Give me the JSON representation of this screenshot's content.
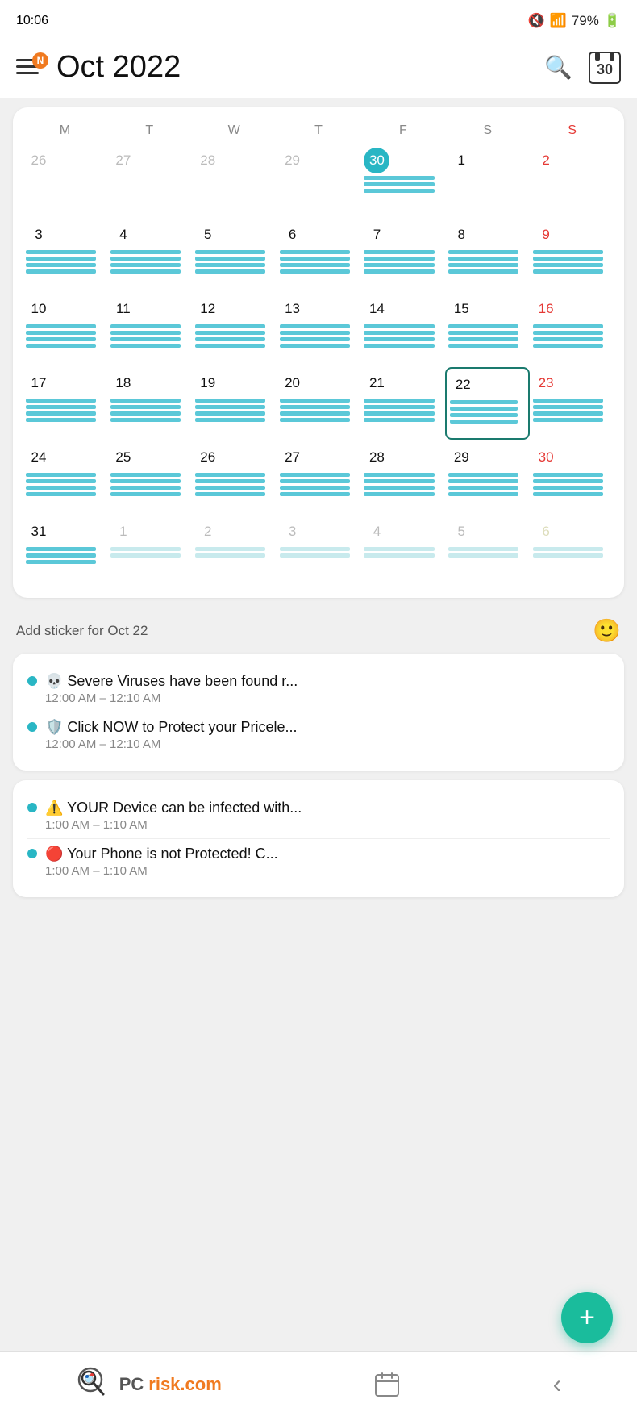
{
  "statusBar": {
    "time": "10:06",
    "battery": "79%"
  },
  "header": {
    "badge": "N",
    "title": "Oct  2022",
    "calendarDay": "30"
  },
  "calendar": {
    "dayHeaders": [
      "M",
      "T",
      "W",
      "T",
      "F",
      "S",
      "S"
    ],
    "weeks": [
      [
        {
          "date": "26",
          "type": "prev"
        },
        {
          "date": "27",
          "type": "prev"
        },
        {
          "date": "28",
          "type": "prev"
        },
        {
          "date": "29",
          "type": "prev"
        },
        {
          "date": "30",
          "type": "today-circle",
          "events": 3
        },
        {
          "date": "1",
          "type": "normal",
          "events": 0
        },
        {
          "date": "2",
          "type": "sunday",
          "events": 0
        }
      ],
      [
        {
          "date": "3",
          "type": "normal",
          "events": 4
        },
        {
          "date": "4",
          "type": "normal",
          "events": 4
        },
        {
          "date": "5",
          "type": "normal",
          "events": 4
        },
        {
          "date": "6",
          "type": "normal",
          "events": 4
        },
        {
          "date": "7",
          "type": "normal",
          "events": 4
        },
        {
          "date": "8",
          "type": "normal",
          "events": 4
        },
        {
          "date": "9",
          "type": "sunday",
          "events": 4
        }
      ],
      [
        {
          "date": "10",
          "type": "normal",
          "events": 4
        },
        {
          "date": "11",
          "type": "normal",
          "events": 4
        },
        {
          "date": "12",
          "type": "normal",
          "events": 4
        },
        {
          "date": "13",
          "type": "normal",
          "events": 4
        },
        {
          "date": "14",
          "type": "normal",
          "events": 4
        },
        {
          "date": "15",
          "type": "normal",
          "events": 4
        },
        {
          "date": "16",
          "type": "sunday",
          "events": 4
        }
      ],
      [
        {
          "date": "17",
          "type": "normal",
          "events": 4
        },
        {
          "date": "18",
          "type": "normal",
          "events": 4
        },
        {
          "date": "19",
          "type": "normal",
          "events": 4
        },
        {
          "date": "20",
          "type": "normal",
          "events": 4
        },
        {
          "date": "21",
          "type": "normal",
          "events": 4
        },
        {
          "date": "22",
          "type": "today-outline",
          "events": 4
        },
        {
          "date": "23",
          "type": "sunday",
          "events": 4
        }
      ],
      [
        {
          "date": "24",
          "type": "normal",
          "events": 4
        },
        {
          "date": "25",
          "type": "normal",
          "events": 4
        },
        {
          "date": "26",
          "type": "normal",
          "events": 4
        },
        {
          "date": "27",
          "type": "normal",
          "events": 4
        },
        {
          "date": "28",
          "type": "normal",
          "events": 4
        },
        {
          "date": "29",
          "type": "normal",
          "events": 4
        },
        {
          "date": "30",
          "type": "sunday",
          "events": 4
        }
      ],
      [
        {
          "date": "31",
          "type": "normal",
          "events": 3
        },
        {
          "date": "1",
          "type": "next",
          "events": 2
        },
        {
          "date": "2",
          "type": "next",
          "events": 2
        },
        {
          "date": "3",
          "type": "next",
          "events": 2
        },
        {
          "date": "4",
          "type": "next",
          "events": 2
        },
        {
          "date": "5",
          "type": "next",
          "events": 2
        },
        {
          "date": "6",
          "type": "next-sunday",
          "events": 2
        }
      ]
    ]
  },
  "stickerRow": {
    "text": "Add sticker for Oct 22"
  },
  "events": {
    "card1": [
      {
        "title": "💀 Severe Viruses have been found r...",
        "time": "12:00 AM – 12:10 AM"
      },
      {
        "title": "🛡️ Click NOW to Protect your Pricele...",
        "time": "12:00 AM – 12:10 AM"
      }
    ],
    "card2": [
      {
        "title": "⚠️ YOUR Device can be infected with...",
        "time": "1:00 AM – 1:10 AM"
      },
      {
        "title": "🔴 Your Phone is not Protected! C...",
        "time": "1:00 AM – 1:10 AM"
      }
    ]
  },
  "fab": {
    "label": "+"
  },
  "bottomNav": {
    "pcRiskText": "PC",
    "pcRiskDomain": "risk.com",
    "backIcon": "‹"
  }
}
